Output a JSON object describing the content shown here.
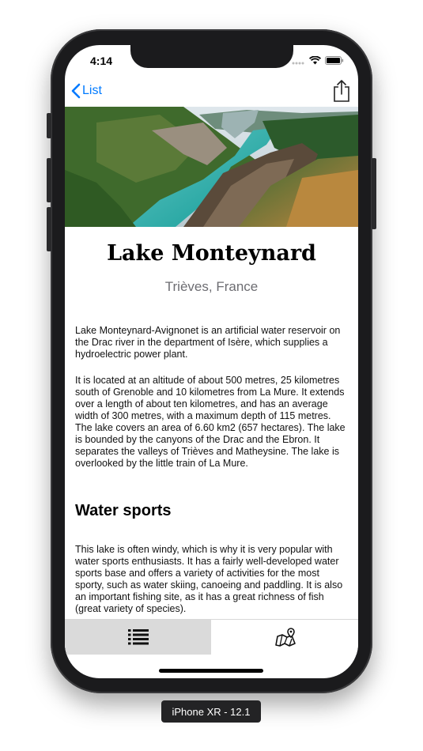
{
  "status_bar": {
    "time": "4:14"
  },
  "nav": {
    "back_label": "List",
    "back_icon": "chevron-left-icon",
    "share_icon": "share-icon"
  },
  "hero": {
    "image": "lake-canyon-photo"
  },
  "place": {
    "title": "Lake Monteynard",
    "subtitle": "Trièves, France"
  },
  "description": {
    "paragraph1": "Lake Monteynard-Avignonet is an artificial water reservoir on the Drac river in the department of Isère, which supplies a hydroelectric power plant.",
    "paragraph2": "It is located at an altitude of about 500 metres, 25 kilometres south of Grenoble and 10 kilometres from La Mure. It extends over a length of about ten kilometres, and has an average width of 300 metres, with a maximum depth of 115 metres. The lake covers an area of 6.60 km2 (657 hectares). The lake is bounded by the canyons of the Drac and the Ebron. It separates the valleys of Trièves and Matheysine. The lake is overlooked by the little train of La Mure.",
    "section_heading": "Water sports",
    "paragraph3": "This lake is often windy, which is why it is very popular with water sports enthusiasts. It has a fairly well-developed water sports base and offers a variety of activities for the most sporty, such as water skiing, canoeing and paddling. It is also an important fishing site, as it has a great richness of fish (great variety of species)."
  },
  "tabs": [
    {
      "icon": "list-icon",
      "active": true
    },
    {
      "icon": "map-pin-icon",
      "active": false
    }
  ],
  "device_label": "iPhone XR - 12.1",
  "colors": {
    "accent": "#007aff",
    "tab_active_bg": "#dadada",
    "subtitle": "#6d6d72"
  }
}
